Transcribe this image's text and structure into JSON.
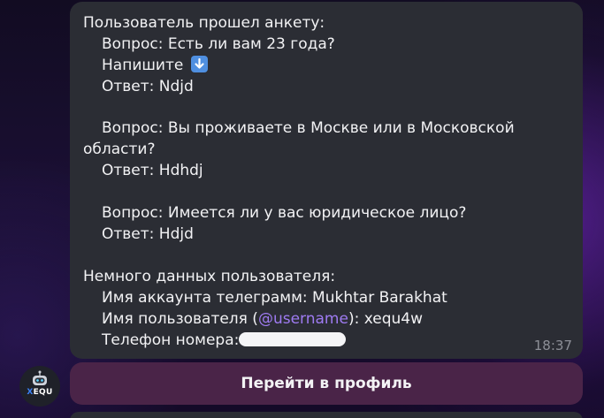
{
  "message": {
    "header": "Пользователь прошел анкету:",
    "q1": "Вопрос: Есть ли вам 23 года?",
    "q1_hint": "Напишите",
    "q1_hint_icon": "down-arrow-emoji",
    "a1": "Ответ: Ndjd",
    "q2_line1": "Вопрос: Вы проживаете в Москве или в Московской",
    "q2_line2": "области?",
    "a2": "Ответ: Hdhdj",
    "q3": "Вопрос: Имеется ли у вас юридическое лицо?",
    "a3": "Ответ: Hdjd",
    "user_header": "Немного данных пользователя:",
    "account_name": "Имя аккаунта телеграмм: Mukhtar Barakhat",
    "username_prefix": "Имя пользователя (",
    "username_mention": "@username",
    "username_suffix": "): xequ4w",
    "phone_label": "Телефон номера:",
    "time": "18:37"
  },
  "avatar": {
    "brand_x": "X",
    "brand_rest": "EQU"
  },
  "buttons": {
    "profile": "Перейти в профиль"
  },
  "colors": {
    "bubble": "#2b2d34",
    "mention": "#9f7bf2",
    "button": "#4a2448",
    "emoji_blue": "#4f8fe0"
  }
}
